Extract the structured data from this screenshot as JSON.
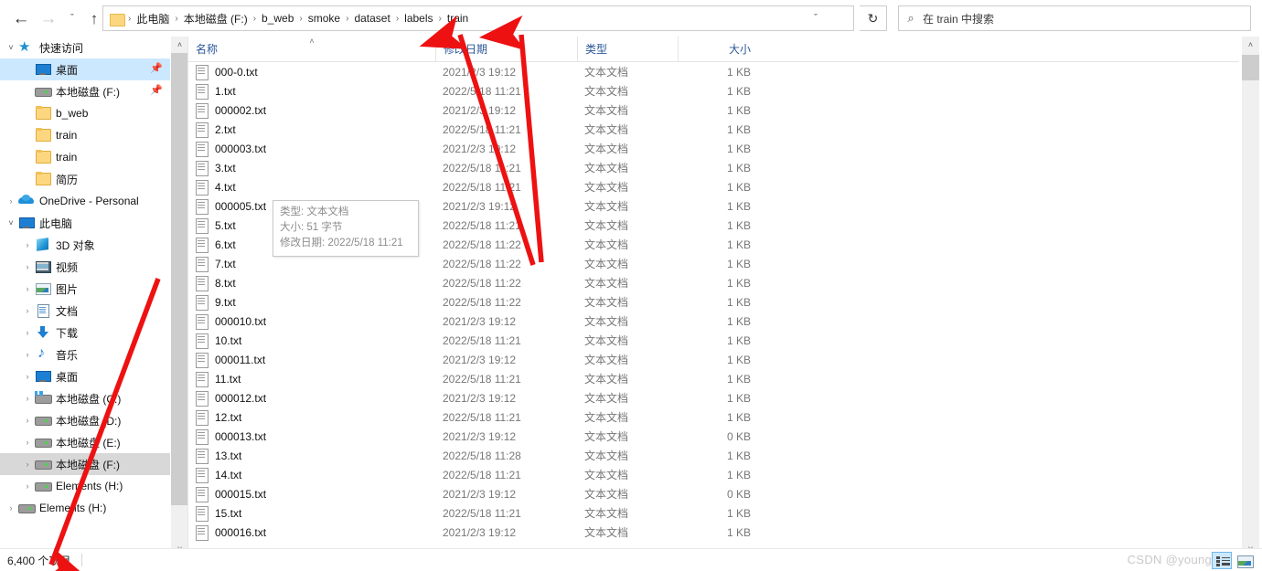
{
  "window": {
    "title": "train"
  },
  "toolbar": {
    "back_icon": "←",
    "forward_icon": "→",
    "recent_icon": "ˇ",
    "up_icon": "↑",
    "address_dropdown_icon": "ˇ",
    "refresh_icon": "↻",
    "search_icon": "⌕"
  },
  "breadcrumb": {
    "separator": "›",
    "items": [
      "此电脑",
      "本地磁盘 (F:)",
      "b_web",
      "smoke",
      "dataset",
      "labels",
      "train"
    ]
  },
  "search": {
    "placeholder": "在 train 中搜索"
  },
  "sidebar": {
    "items": [
      {
        "label": "快速访问",
        "icon": "star-icon",
        "indent": 0,
        "twisty": "open",
        "state": "normal",
        "pinned": false
      },
      {
        "label": "桌面",
        "icon": "monitor-icon",
        "indent": 1,
        "twisty": "none",
        "state": "selected",
        "pinned": true
      },
      {
        "label": "本地磁盘 (F:)",
        "icon": "drive-icon",
        "indent": 1,
        "twisty": "none",
        "state": "normal",
        "pinned": true
      },
      {
        "label": "b_web",
        "icon": "folder-icon",
        "indent": 1,
        "twisty": "none",
        "state": "normal",
        "pinned": false
      },
      {
        "label": "train",
        "icon": "folder-icon",
        "indent": 1,
        "twisty": "none",
        "state": "normal",
        "pinned": false
      },
      {
        "label": "train",
        "icon": "folder-icon",
        "indent": 1,
        "twisty": "none",
        "state": "normal",
        "pinned": false
      },
      {
        "label": "简历",
        "icon": "folder-icon",
        "indent": 1,
        "twisty": "none",
        "state": "normal",
        "pinned": false
      },
      {
        "label": "OneDrive - Personal",
        "icon": "cloud-icon",
        "indent": 0,
        "twisty": "closed",
        "state": "normal",
        "pinned": false
      },
      {
        "label": "此电脑",
        "icon": "monitor-icon",
        "indent": 0,
        "twisty": "open",
        "state": "normal",
        "pinned": false
      },
      {
        "label": "3D 对象",
        "icon": "3d-objects-icon",
        "indent": 1,
        "twisty": "closed",
        "state": "normal",
        "pinned": false
      },
      {
        "label": "视频",
        "icon": "video-icon",
        "indent": 1,
        "twisty": "closed",
        "state": "normal",
        "pinned": false
      },
      {
        "label": "图片",
        "icon": "picture-icon",
        "indent": 1,
        "twisty": "closed",
        "state": "normal",
        "pinned": false
      },
      {
        "label": "文档",
        "icon": "document-icon",
        "indent": 1,
        "twisty": "closed",
        "state": "normal",
        "pinned": false
      },
      {
        "label": "下载",
        "icon": "download-icon",
        "indent": 1,
        "twisty": "closed",
        "state": "normal",
        "pinned": false
      },
      {
        "label": "音乐",
        "icon": "music-icon",
        "indent": 1,
        "twisty": "closed",
        "state": "normal",
        "pinned": false
      },
      {
        "label": "桌面",
        "icon": "monitor-icon",
        "indent": 1,
        "twisty": "closed",
        "state": "normal",
        "pinned": false
      },
      {
        "label": "本地磁盘 (C:)",
        "icon": "system-drive-icon",
        "indent": 1,
        "twisty": "closed",
        "state": "normal",
        "pinned": false
      },
      {
        "label": "本地磁盘 (D:)",
        "icon": "drive-icon",
        "indent": 1,
        "twisty": "closed",
        "state": "normal",
        "pinned": false
      },
      {
        "label": "本地磁盘 (E:)",
        "icon": "drive-icon",
        "indent": 1,
        "twisty": "closed",
        "state": "normal",
        "pinned": false
      },
      {
        "label": "本地磁盘 (F:)",
        "icon": "drive-icon",
        "indent": 1,
        "twisty": "closed",
        "state": "hover",
        "pinned": false
      },
      {
        "label": "Elements (H:)",
        "icon": "drive-icon",
        "indent": 1,
        "twisty": "closed",
        "state": "normal",
        "pinned": false
      },
      {
        "label": "Elements (H:)",
        "icon": "drive-icon",
        "indent": 0,
        "twisty": "closed",
        "state": "normal",
        "pinned": false
      }
    ]
  },
  "filelist": {
    "columns": [
      {
        "key": "name",
        "label": "名称",
        "sorted": "asc"
      },
      {
        "key": "date",
        "label": "修改日期",
        "sorted": ""
      },
      {
        "key": "type",
        "label": "类型",
        "sorted": ""
      },
      {
        "key": "size",
        "label": "大小",
        "sorted": ""
      }
    ],
    "sort_caret_icon": "˄",
    "rows": [
      {
        "name": "000-0.txt",
        "date": "2021/2/3 19:12",
        "type": "文本文档",
        "size": "1 KB"
      },
      {
        "name": "1.txt",
        "date": "2022/5/18 11:21",
        "type": "文本文档",
        "size": "1 KB"
      },
      {
        "name": "000002.txt",
        "date": "2021/2/3 19:12",
        "type": "文本文档",
        "size": "1 KB"
      },
      {
        "name": "2.txt",
        "date": "2022/5/18 11:21",
        "type": "文本文档",
        "size": "1 KB"
      },
      {
        "name": "000003.txt",
        "date": "2021/2/3 19:12",
        "type": "文本文档",
        "size": "1 KB"
      },
      {
        "name": "3.txt",
        "date": "2022/5/18 11:21",
        "type": "文本文档",
        "size": "1 KB"
      },
      {
        "name": "4.txt",
        "date": "2022/5/18 11:21",
        "type": "文本文档",
        "size": "1 KB"
      },
      {
        "name": "000005.txt",
        "date": "2021/2/3 19:12",
        "type": "文本文档",
        "size": "1 KB"
      },
      {
        "name": "5.txt",
        "date": "2022/5/18 11:21",
        "type": "文本文档",
        "size": "1 KB"
      },
      {
        "name": "6.txt",
        "date": "2022/5/18 11:22",
        "type": "文本文档",
        "size": "1 KB"
      },
      {
        "name": "7.txt",
        "date": "2022/5/18 11:22",
        "type": "文本文档",
        "size": "1 KB"
      },
      {
        "name": "8.txt",
        "date": "2022/5/18 11:22",
        "type": "文本文档",
        "size": "1 KB"
      },
      {
        "name": "9.txt",
        "date": "2022/5/18 11:22",
        "type": "文本文档",
        "size": "1 KB"
      },
      {
        "name": "000010.txt",
        "date": "2021/2/3 19:12",
        "type": "文本文档",
        "size": "1 KB"
      },
      {
        "name": "10.txt",
        "date": "2022/5/18 11:21",
        "type": "文本文档",
        "size": "1 KB"
      },
      {
        "name": "000011.txt",
        "date": "2021/2/3 19:12",
        "type": "文本文档",
        "size": "1 KB"
      },
      {
        "name": "11.txt",
        "date": "2022/5/18 11:21",
        "type": "文本文档",
        "size": "1 KB"
      },
      {
        "name": "000012.txt",
        "date": "2021/2/3 19:12",
        "type": "文本文档",
        "size": "1 KB"
      },
      {
        "name": "12.txt",
        "date": "2022/5/18 11:21",
        "type": "文本文档",
        "size": "1 KB"
      },
      {
        "name": "000013.txt",
        "date": "2021/2/3 19:12",
        "type": "文本文档",
        "size": "0 KB"
      },
      {
        "name": "13.txt",
        "date": "2022/5/18 11:28",
        "type": "文本文档",
        "size": "1 KB"
      },
      {
        "name": "14.txt",
        "date": "2022/5/18 11:21",
        "type": "文本文档",
        "size": "1 KB"
      },
      {
        "name": "000015.txt",
        "date": "2021/2/3 19:12",
        "type": "文本文档",
        "size": "0 KB"
      },
      {
        "name": "15.txt",
        "date": "2022/5/18 11:21",
        "type": "文本文档",
        "size": "1 KB"
      },
      {
        "name": "000016.txt",
        "date": "2021/2/3 19:12",
        "type": "文本文档",
        "size": "1 KB"
      }
    ]
  },
  "tooltip": {
    "type_line": "类型: 文本文档",
    "size_line": "大小: 51 字节",
    "date_line": "修改日期: 2022/5/18 11:21"
  },
  "statusbar": {
    "item_count": "6,400 个项目"
  },
  "watermark": {
    "text": "CSDN @young-py"
  },
  "scrollbar": {
    "up_icon": "˄",
    "down_icon": "˅"
  },
  "annotations": {
    "arrow_color": "#ee1111",
    "count": 3
  }
}
